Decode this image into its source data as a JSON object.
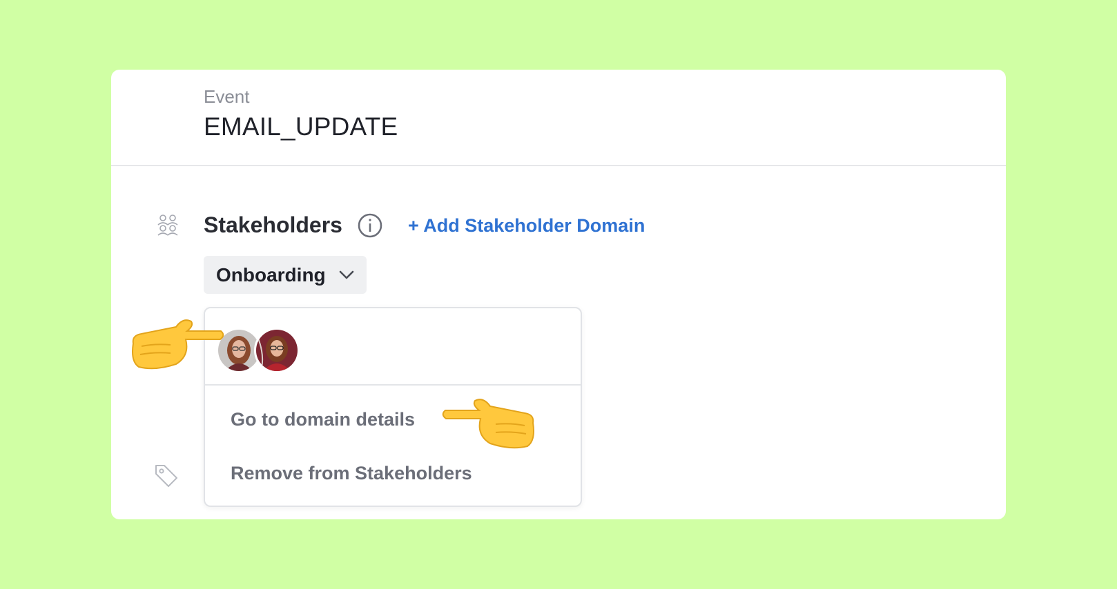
{
  "event": {
    "label": "Event",
    "name": "EMAIL_UPDATE"
  },
  "stakeholders": {
    "title": "Stakeholders",
    "add_link": "+ Add Stakeholder Domain",
    "domain_selected": "Onboarding"
  },
  "menu": {
    "avatars": [
      "avatar-1",
      "avatar-2"
    ],
    "items": [
      "Go to domain details",
      "Remove from Stakeholders"
    ]
  },
  "icons": [
    "people-icon",
    "info-icon",
    "chevron-down-icon",
    "tag-icon",
    "pointing-hand-icon"
  ],
  "colors": {
    "background": "#d0ffa4",
    "link": "#2f72d2",
    "card": "#ffffff"
  }
}
